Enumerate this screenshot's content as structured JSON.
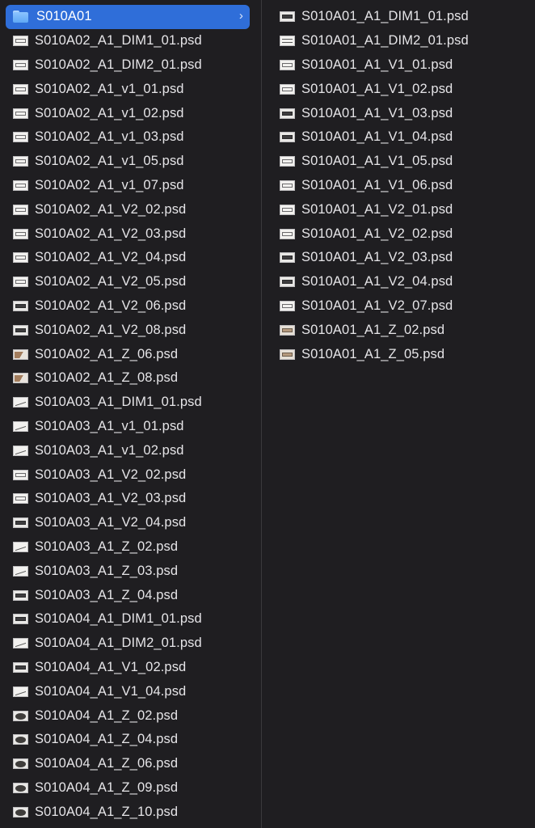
{
  "columns": {
    "left": [
      {
        "name": "S010A01",
        "kind": "folder",
        "selected": true
      },
      {
        "name": "S010A02_A1_DIM1_01.psd",
        "thumb": "frame"
      },
      {
        "name": "S010A02_A1_DIM2_01.psd",
        "thumb": "frame"
      },
      {
        "name": "S010A02_A1_v1_01.psd",
        "thumb": "frame"
      },
      {
        "name": "S010A02_A1_v1_02.psd",
        "thumb": "frame"
      },
      {
        "name": "S010A02_A1_v1_03.psd",
        "thumb": "frame"
      },
      {
        "name": "S010A02_A1_v1_05.psd",
        "thumb": "frame"
      },
      {
        "name": "S010A02_A1_v1_07.psd",
        "thumb": "frame"
      },
      {
        "name": "S010A02_A1_V2_02.psd",
        "thumb": "frame"
      },
      {
        "name": "S010A02_A1_V2_03.psd",
        "thumb": "frame"
      },
      {
        "name": "S010A02_A1_V2_04.psd",
        "thumb": "frame"
      },
      {
        "name": "S010A02_A1_V2_05.psd",
        "thumb": "frame"
      },
      {
        "name": "S010A02_A1_V2_06.psd",
        "thumb": "dark"
      },
      {
        "name": "S010A02_A1_V2_08.psd",
        "thumb": "dark"
      },
      {
        "name": "S010A02_A1_Z_06.psd",
        "thumb": "wood"
      },
      {
        "name": "S010A02_A1_Z_08.psd",
        "thumb": "wood"
      },
      {
        "name": "S010A03_A1_DIM1_01.psd",
        "thumb": "sketch"
      },
      {
        "name": "S010A03_A1_v1_01.psd",
        "thumb": "sketch"
      },
      {
        "name": "S010A03_A1_v1_02.psd",
        "thumb": "sketch"
      },
      {
        "name": "S010A03_A1_V2_02.psd",
        "thumb": "frame"
      },
      {
        "name": "S010A03_A1_V2_03.psd",
        "thumb": "frame"
      },
      {
        "name": "S010A03_A1_V2_04.psd",
        "thumb": "dark"
      },
      {
        "name": "S010A03_A1_Z_02.psd",
        "thumb": "sketch"
      },
      {
        "name": "S010A03_A1_Z_03.psd",
        "thumb": "sketch"
      },
      {
        "name": "S010A03_A1_Z_04.psd",
        "thumb": "dark"
      },
      {
        "name": "S010A04_A1_DIM1_01.psd",
        "thumb": "dark"
      },
      {
        "name": "S010A04_A1_DIM2_01.psd",
        "thumb": "sketch"
      },
      {
        "name": "S010A04_A1_V1_02.psd",
        "thumb": "dark"
      },
      {
        "name": "S010A04_A1_V1_04.psd",
        "thumb": "sketch"
      },
      {
        "name": "S010A04_A1_Z_02.psd",
        "thumb": "blob"
      },
      {
        "name": "S010A04_A1_Z_04.psd",
        "thumb": "blob"
      },
      {
        "name": "S010A04_A1_Z_06.psd",
        "thumb": "blob"
      },
      {
        "name": "S010A04_A1_Z_09.psd",
        "thumb": "blob"
      },
      {
        "name": "S010A04_A1_Z_10.psd",
        "thumb": "blob"
      }
    ],
    "right": [
      {
        "name": "S010A01_A1_DIM1_01.psd",
        "thumb": "dark"
      },
      {
        "name": "S010A01_A1_DIM2_01.psd",
        "thumb": "lined"
      },
      {
        "name": "S010A01_A1_V1_01.psd",
        "thumb": "frame"
      },
      {
        "name": "S010A01_A1_V1_02.psd",
        "thumb": "frame"
      },
      {
        "name": "S010A01_A1_V1_03.psd",
        "thumb": "dark"
      },
      {
        "name": "S010A01_A1_V1_04.psd",
        "thumb": "dark"
      },
      {
        "name": "S010A01_A1_V1_05.psd",
        "thumb": "frame"
      },
      {
        "name": "S010A01_A1_V1_06.psd",
        "thumb": "frame"
      },
      {
        "name": "S010A01_A1_V2_01.psd",
        "thumb": "frame"
      },
      {
        "name": "S010A01_A1_V2_02.psd",
        "thumb": "frame"
      },
      {
        "name": "S010A01_A1_V2_03.psd",
        "thumb": "dark"
      },
      {
        "name": "S010A01_A1_V2_04.psd",
        "thumb": "dark"
      },
      {
        "name": "S010A01_A1_V2_07.psd",
        "thumb": "frame"
      },
      {
        "name": "S010A01_A1_Z_02.psd",
        "thumb": "warm"
      },
      {
        "name": "S010A01_A1_Z_05.psd",
        "thumb": "warm"
      }
    ]
  },
  "colors": {
    "background": "#1f1e21",
    "selection": "#2f6ed9",
    "text": "#e6e5e8",
    "divider": "#3a393c"
  },
  "icons": {
    "folder": "folder-icon",
    "file": "psd-thumbnail-icon",
    "disclosure": "chevron-right-icon"
  }
}
